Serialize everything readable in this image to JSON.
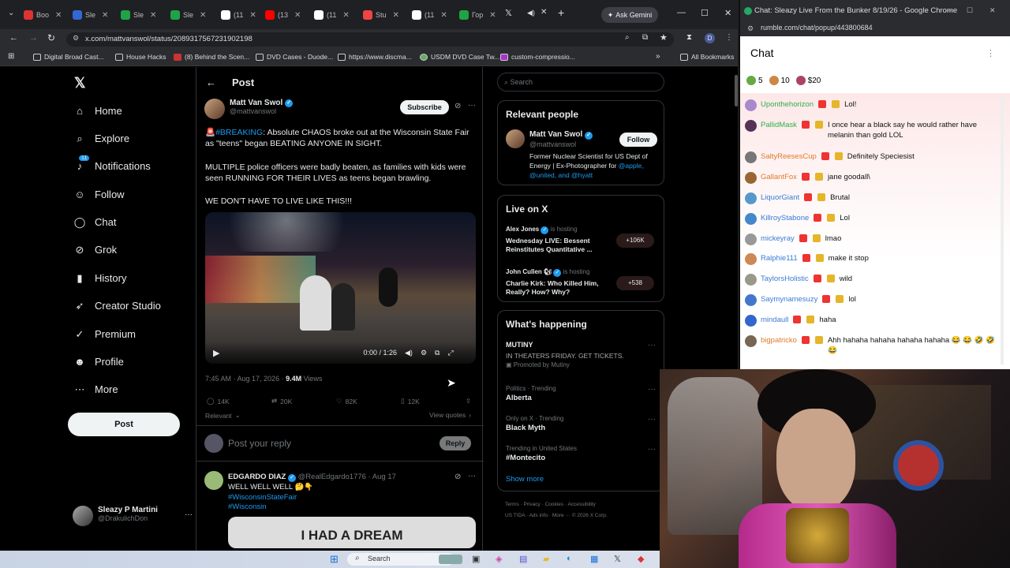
{
  "tabs": [
    {
      "label": "Boo",
      "color": "#d33"
    },
    {
      "label": "Sle",
      "color": "#3367d6"
    },
    {
      "label": "Sle",
      "color": "#1ea446"
    },
    {
      "label": "Sle",
      "color": "#1ea446"
    },
    {
      "label": "(11",
      "color": "#fff"
    },
    {
      "label": "(13",
      "color": "#f00"
    },
    {
      "label": "(11",
      "color": "#fff"
    },
    {
      "label": "Stu",
      "color": "#e44"
    },
    {
      "label": "(11",
      "color": "#fff"
    },
    {
      "label": "Гор",
      "color": "#1ea446"
    }
  ],
  "ask_gemini": "Ask Gemini",
  "url": "x.com/mattvanswol/status/2089317567231902198",
  "bookmarks": [
    "Digital Broad Cast...",
    "House Hacks",
    "(8) Behind the Scen...",
    "DVD Cases - Duode...",
    "https://www.discma...",
    "USDM DVD Case Tw...",
    "custom-compressio..."
  ],
  "all_bookmarks": "All Bookmarks",
  "nav": [
    {
      "label": "Home",
      "icon": "home-icon",
      "glyph": "⌂"
    },
    {
      "label": "Explore",
      "icon": "search-icon",
      "glyph": "⌕"
    },
    {
      "label": "Notifications",
      "icon": "bell-icon",
      "glyph": "♪"
    },
    {
      "label": "Follow",
      "icon": "person-plus-icon",
      "glyph": "☺"
    },
    {
      "label": "Chat",
      "icon": "chat-icon",
      "glyph": "◯"
    },
    {
      "label": "Grok",
      "icon": "grok-icon",
      "glyph": "⊘"
    },
    {
      "label": "History",
      "icon": "bookmark-icon",
      "glyph": "▮"
    },
    {
      "label": "Creator Studio",
      "icon": "rocket-icon",
      "glyph": "➶"
    },
    {
      "label": "Premium",
      "icon": "verified-icon",
      "glyph": "✓"
    },
    {
      "label": "Profile",
      "icon": "person-icon",
      "glyph": "☻"
    },
    {
      "label": "More",
      "icon": "more-icon",
      "glyph": "⋯"
    }
  ],
  "notif_count": "11",
  "post_button": "Post",
  "account": {
    "name": "Sleazy P Martini",
    "handle": "@DrakulichDon"
  },
  "post_header": "Post",
  "author": {
    "name": "Matt Van Swol",
    "handle": "@mattvanswol"
  },
  "subscribe": "Subscribe",
  "post": {
    "hashtag": "#BREAKING",
    "line1": ": Absolute CHAOS broke out at the Wisconsin State Fair as \"teens\" began BEATING ANYONE IN SIGHT.",
    "line2": "MULTIPLE police officers were badly beaten, as families with kids were seen RUNNING FOR THEIR LIVES as teens began brawling.",
    "line3": "WE DON'T HAVE TO LIVE LIKE THIS!!!"
  },
  "video_time": "0:00 / 1:26",
  "meta": {
    "time": "7:45 AM · Aug 17, 2026 · ",
    "views": "9.4M",
    "views_label": " Views"
  },
  "counts": {
    "replies": "14K",
    "reposts": "20K",
    "likes": "82K",
    "bookmarks": "12K"
  },
  "relevant": "Relevant",
  "view_quotes": "View quotes",
  "reply_placeholder": "Post your reply",
  "reply_button": "Reply",
  "reply2": {
    "name": "EDGARDO DIAZ",
    "handle": "@RealEdgardo1776 · Aug 17",
    "text": "WELL WELL WELL 🤔👇",
    "tag1": "#WisconsinStateFair",
    "tag2": "#Wisconsin",
    "img_text": "I HAD A DREAM"
  },
  "search_placeholder": "Search",
  "relevant_people": {
    "title": "Relevant people",
    "name": "Matt Van Swol",
    "handle": "@mattvanswol",
    "follow": "Follow",
    "bio": "Former Nuclear Scientist for US Dept of Energy | Ex-Photographer for ",
    "bio_links": "@apple, @united, and @hyatt"
  },
  "live": {
    "title": "Live on X",
    "items": [
      {
        "host": "Alex Jones",
        "status": "is hosting",
        "title": "Wednesday LIVE: Bessent Reinstitutes Quantitative ...",
        "count": "+106K"
      },
      {
        "host": "John Cullen 🐿",
        "status": "is hosting",
        "title": "Charlie Kirk: Who Killed Him, Really? How? Why?",
        "count": "+538"
      }
    ]
  },
  "happening": {
    "title": "What's happening",
    "ad_title": "MUTINY",
    "ad_text": "IN THEATERS FRIDAY. GET TICKETS.",
    "ad_promo": "Promoted by Mutiny",
    "trends": [
      {
        "ctx": "Politics · Trending",
        "name": "Alberta"
      },
      {
        "ctx": "Only on X · Trending",
        "name": "Black Myth"
      },
      {
        "ctx": "Trending in United States",
        "name": "#Montecito"
      }
    ],
    "show_more": "Show more"
  },
  "footer": {
    "line1": "Terms · Privacy · Cookies · Accessibility",
    "line2": "US TIDA · Ads info · More ··· © 2026 X Corp."
  },
  "chat": {
    "window_title": "Chat: Sleazy Live From the Bunker 8/19/26 - Google Chrome",
    "url": "rumble.com/chat/popup/443800684",
    "title": "Chat",
    "gifts": [
      {
        "n": "5",
        "c": "#6a4"
      },
      {
        "n": "10",
        "c": "#c84"
      },
      {
        "n": "$20",
        "c": "#a46"
      }
    ],
    "messages": [
      {
        "user": "Uponthehorizon",
        "color": "#2db04a",
        "text": "Lol!",
        "av": "#a8c"
      },
      {
        "user": "PallidMask",
        "color": "#2db04a",
        "text": "I once hear a black say he would rather have melanin than gold LOL",
        "av": "#535"
      },
      {
        "user": "SaltyReesesCup",
        "color": "#e07a2a",
        "text": "Definitely Speciesist",
        "av": "#777"
      },
      {
        "user": "GallantFox",
        "color": "#e07a2a",
        "text": "jane goodall\\",
        "av": "#963"
      },
      {
        "user": "LiquorGiant",
        "color": "#3a7bd5",
        "text": "Brutal",
        "av": "#59c"
      },
      {
        "user": "KillroyStabone",
        "color": "#3a7bd5",
        "text": "Lol",
        "av": "#48c"
      },
      {
        "user": "mickeyray",
        "color": "#3a7bd5",
        "text": "lmao",
        "av": "#999"
      },
      {
        "user": "Ralphie111",
        "color": "#3a7bd5",
        "text": "make it stop",
        "av": "#c85"
      },
      {
        "user": "TaylorsHolistic",
        "color": "#3a7bd5",
        "text": "wild",
        "av": "#998"
      },
      {
        "user": "Saymynamesuzy",
        "color": "#3a7bd5",
        "text": "lol",
        "av": "#47c"
      },
      {
        "user": "mindaull",
        "color": "#3a7bd5",
        "text": "haha",
        "av": "#36c"
      },
      {
        "user": "bigpatricko",
        "color": "#e07a2a",
        "text": "Ahh hahaha hahaha hahaha hahaha 😂 😂 🤣 🤣 😂",
        "av": "#765"
      }
    ]
  },
  "taskbar_search": "Search"
}
